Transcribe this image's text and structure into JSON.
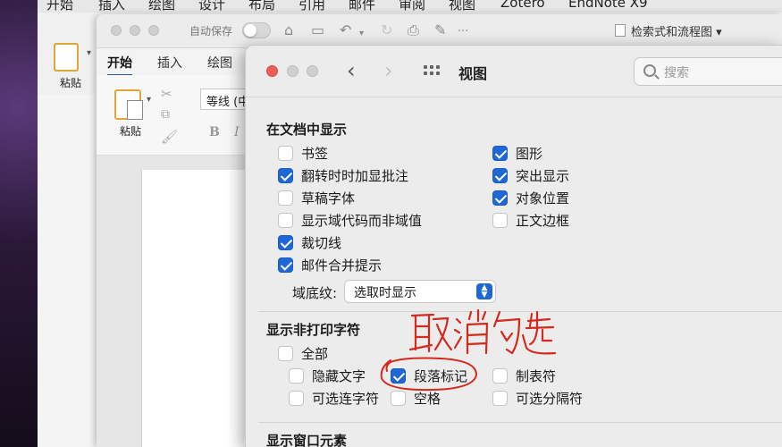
{
  "back_window": {
    "menu": [
      "开始",
      "插入",
      "绘图",
      "设计",
      "布局",
      "引用",
      "邮件",
      "审阅",
      "视图",
      "Zotero",
      "EndNote X9"
    ],
    "paste_label": "粘贴"
  },
  "word_window": {
    "autosave_label": "自动保存",
    "doc_title": "检索式和流程图",
    "tabs": [
      "开始",
      "插入",
      "绘图"
    ],
    "paste_label": "粘贴",
    "font_name": "等线 (中",
    "bold": "B",
    "italic": "I"
  },
  "preferences": {
    "title": "视图",
    "search_placeholder": "搜索",
    "section_show_in_doc": {
      "title": "在文档中显示",
      "left": [
        {
          "label": "书签",
          "checked": false
        },
        {
          "label": "翻转时时加显批注",
          "checked": true
        },
        {
          "label": "草稿字体",
          "checked": false
        },
        {
          "label": "显示域代码而非域值",
          "checked": false
        },
        {
          "label": "裁切线",
          "checked": true
        },
        {
          "label": "邮件合并提示",
          "checked": true
        }
      ],
      "right": [
        {
          "label": "图形",
          "checked": true
        },
        {
          "label": "突出显示",
          "checked": true
        },
        {
          "label": "对象位置",
          "checked": true
        },
        {
          "label": "正文边框",
          "checked": false
        }
      ],
      "field_shading_label": "域底纹:",
      "field_shading_value": "选取时显示"
    },
    "section_nonprinting": {
      "title": "显示非打印字符",
      "all": {
        "label": "全部",
        "checked": false
      },
      "items": [
        {
          "label": "隐藏文字",
          "checked": false
        },
        {
          "label": "段落标记",
          "checked": true
        },
        {
          "label": "制表符",
          "checked": false
        },
        {
          "label": "可选连字符",
          "checked": false
        },
        {
          "label": "空格",
          "checked": false
        },
        {
          "label": "可选分隔符",
          "checked": false
        }
      ]
    },
    "section_window": {
      "title": "显示窗口元素"
    },
    "annotation": {
      "handwritten_text": "取消勾选",
      "color": "#d42a1e"
    }
  }
}
